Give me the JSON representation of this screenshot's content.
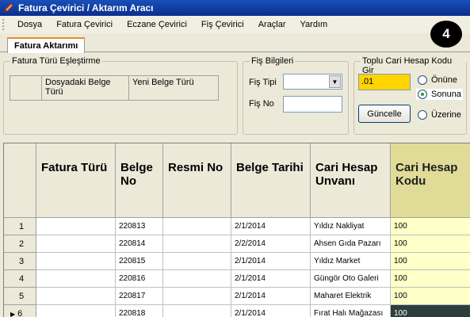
{
  "window": {
    "title": "Fatura Çevirici / Aktarım Aracı",
    "icon": "pencil-app-icon"
  },
  "menu": [
    "Dosya",
    "Fatura Çevirici",
    "Eczane Çevirici",
    "Fiş Çevirici",
    "Araçlar",
    "Yardım"
  ],
  "badge": "4",
  "tab": {
    "label": "Fatura Aktarımı"
  },
  "fatura_turu_group": {
    "title": "Fatura Türü Eşleştirme",
    "col1": "Dosyadaki Belge Türü",
    "col2": "Yeni Belge Türü"
  },
  "fis_group": {
    "title": "Fiş Bilgileri",
    "fis_tipi_label": "Fiş Tipi",
    "fis_tipi_value": "",
    "fis_no_label": "Fiş No",
    "fis_no_value": ""
  },
  "toplu_group": {
    "title": "Toplu Cari Hesap Kodu Gir",
    "code_value": ".01",
    "button_label": "Güncelle",
    "radios": [
      {
        "label": "Önüne",
        "selected": false
      },
      {
        "label": "Sonuna",
        "selected": true
      },
      {
        "label": "Üzerine",
        "selected": false
      }
    ]
  },
  "grid": {
    "columns": [
      "Fatura Türü",
      "Belge No",
      "Resmi No",
      "Belge Tarihi",
      "Cari Hesap Unvanı",
      "Cari Hesap Kodu"
    ],
    "highlight_color": "#e0dc98",
    "rows": [
      {
        "num": "1",
        "fatura_turu": "",
        "belge_no": "220813",
        "resmi_no": "",
        "tarih": "2/1/2014",
        "unvan": "Yıldız Nakliyat",
        "kod": "100"
      },
      {
        "num": "2",
        "fatura_turu": "",
        "belge_no": "220814",
        "resmi_no": "",
        "tarih": "2/2/2014",
        "unvan": "Ahsen Gıda Pazarı",
        "kod": "100"
      },
      {
        "num": "3",
        "fatura_turu": "",
        "belge_no": "220815",
        "resmi_no": "",
        "tarih": "2/1/2014",
        "unvan": "Yıldız Market",
        "kod": "100"
      },
      {
        "num": "4",
        "fatura_turu": "",
        "belge_no": "220816",
        "resmi_no": "",
        "tarih": "2/1/2014",
        "unvan": "Güngör Oto Galeri",
        "kod": "100"
      },
      {
        "num": "5",
        "fatura_turu": "",
        "belge_no": "220817",
        "resmi_no": "",
        "tarih": "2/1/2014",
        "unvan": "Maharet Elektrik",
        "kod": "100"
      },
      {
        "num": "6",
        "fatura_turu": "",
        "belge_no": "220818",
        "resmi_no": "",
        "tarih": "2/1/2014",
        "unvan": "Fırat Halı Mağazası",
        "kod": "100",
        "current": true
      }
    ]
  }
}
